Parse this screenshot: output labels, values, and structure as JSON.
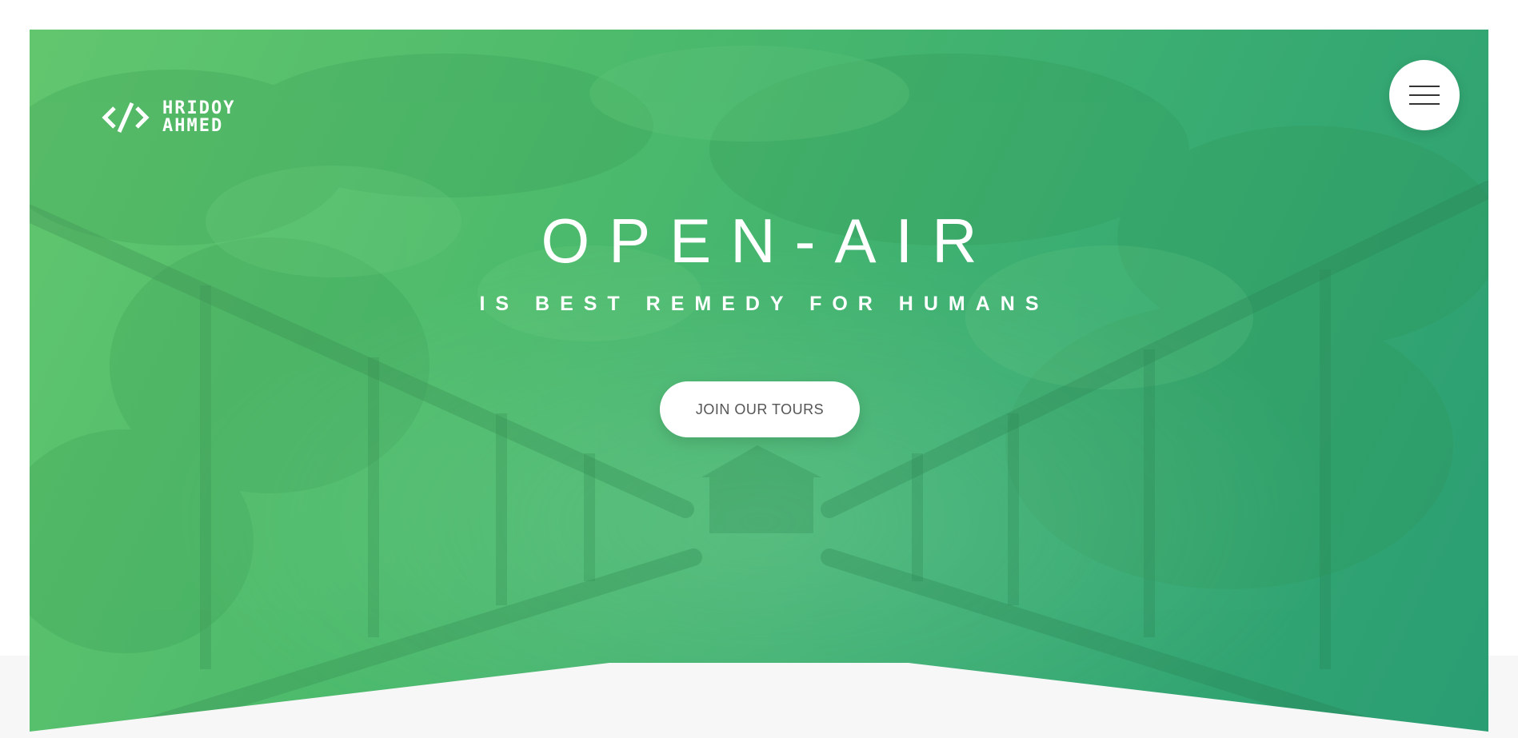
{
  "logo": {
    "line1": "HRIDOY",
    "line2": "AHMED",
    "icon": "code-brackets-icon"
  },
  "menu": {
    "icon": "hamburger-menu-icon"
  },
  "hero": {
    "title": "OPEN-AIR",
    "subtitle": "IS BEST REMEDY FOR HUMANS",
    "cta_label": "JOIN OUR TOURS"
  },
  "colors": {
    "gradient_start": "#62c66e",
    "gradient_end": "#2a9d73",
    "button_bg": "#ffffff",
    "button_text": "#555555",
    "page_bg": "#ffffff",
    "lower_band": "#f7f7f7"
  }
}
